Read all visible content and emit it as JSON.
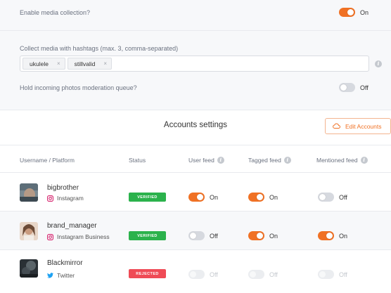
{
  "settings": {
    "media_collection": {
      "label": "Enable media collection?",
      "state": "On"
    },
    "hashtags": {
      "label": "Collect media with hashtags (max. 3, comma-separated)",
      "tags": [
        "ukulele",
        "stillvalid"
      ],
      "remove_glyph": "×"
    },
    "moderation": {
      "label": "Hold incoming photos moderation queue?",
      "state": "Off"
    }
  },
  "accounts_section": {
    "title": "Accounts settings",
    "edit_button": "Edit Accounts"
  },
  "columns": [
    "Username / Platform",
    "Status",
    "User feed",
    "Tagged feed",
    "Mentioned feed"
  ],
  "accounts": [
    {
      "username": "bigbrother",
      "platform": "Instagram",
      "status": "VERIFIED",
      "user_feed": "On",
      "tagged_feed": "On",
      "mentioned_feed": "Off"
    },
    {
      "username": "brand_manager",
      "platform": "Instagram Business",
      "status": "VERIFIED",
      "user_feed": "Off",
      "tagged_feed": "On",
      "mentioned_feed": "On"
    },
    {
      "username": "Blackmirror",
      "platform": "Twitter",
      "status": "REJECTED",
      "user_feed": "Off",
      "tagged_feed": "Off",
      "mentioned_feed": "Off"
    }
  ],
  "colors": {
    "accent": "#f07124",
    "verified": "#2bb24c",
    "rejected": "#ef4b56",
    "instagram": "#d6246e",
    "twitter": "#1da1f2"
  }
}
